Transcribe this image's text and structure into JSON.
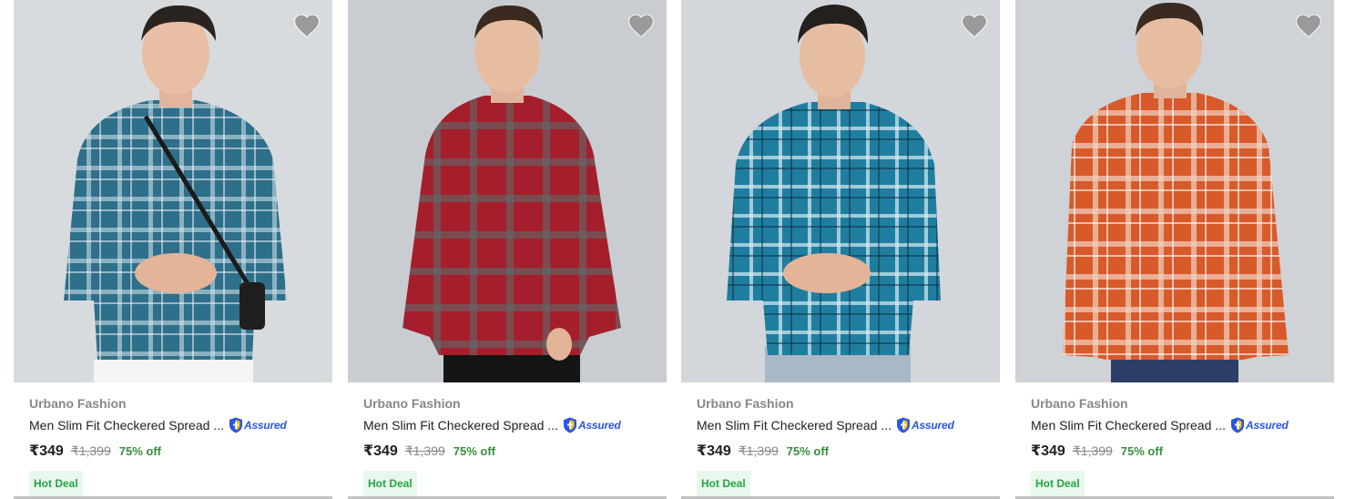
{
  "products": [
    {
      "brand": "Urbano Fashion",
      "title": "Men Slim Fit Checkered Spread ...",
      "assured_label": "Assured",
      "price": "₹349",
      "mrp": "₹1,399",
      "discount": "75% off",
      "badge": "Hot Deal",
      "shirt_color": "#2e6f8a",
      "check_color": "#d7e6ef"
    },
    {
      "brand": "Urbano Fashion",
      "title": "Men Slim Fit Checkered Spread ...",
      "assured_label": "Assured",
      "price": "₹349",
      "mrp": "₹1,399",
      "discount": "75% off",
      "badge": "Hot Deal",
      "shirt_color": "#a41f2b",
      "check_color": "#5e6a6b"
    },
    {
      "brand": "Urbano Fashion",
      "title": "Men Slim Fit Checkered Spread ...",
      "assured_label": "Assured",
      "price": "₹349",
      "mrp": "₹1,399",
      "discount": "75% off",
      "badge": "Hot Deal",
      "shirt_color": "#1f7ea0",
      "check_color": "#d9ecf3"
    },
    {
      "brand": "Urbano Fashion",
      "title": "Men Slim Fit Checkered Spread ...",
      "assured_label": "Assured",
      "price": "₹349",
      "mrp": "₹1,399",
      "discount": "75% off",
      "badge": "Hot Deal",
      "shirt_color": "#d85a2a",
      "check_color": "#f1d2c4"
    }
  ],
  "icons": {
    "wishlist": "heart-icon",
    "assured": "shield-icon"
  },
  "colors": {
    "price_text": "#212121",
    "brand_text": "#878787",
    "discount": "#388e3c",
    "badge_bg": "#e8f8ec",
    "badge_text": "#26a541",
    "assured_blue": "#2a55e5"
  }
}
